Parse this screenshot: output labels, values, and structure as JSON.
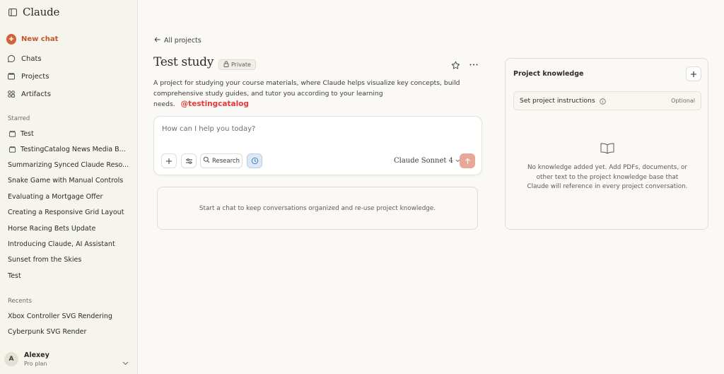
{
  "sidebar": {
    "brand": "Claude",
    "new_chat": "New chat",
    "nav": [
      {
        "label": "Chats",
        "icon": "chat-bubble-icon"
      },
      {
        "label": "Projects",
        "icon": "folder-icon"
      },
      {
        "label": "Artifacts",
        "icon": "artifacts-grid-icon"
      }
    ],
    "starred_heading": "Starred",
    "starred": [
      {
        "label": "Test",
        "icon": "folder-icon"
      },
      {
        "label": "TestingCatalog News Media B...",
        "icon": "folder-icon"
      },
      {
        "label": "Summarizing Synced Claude Reso..."
      },
      {
        "label": "Snake Game with Manual Controls"
      },
      {
        "label": "Evaluating a Mortgage Offer"
      },
      {
        "label": "Creating a Responsive Grid Layout"
      },
      {
        "label": "Horse Racing Bets Update"
      },
      {
        "label": "Introducing Claude, AI Assistant"
      },
      {
        "label": "Sunset from the Skies"
      },
      {
        "label": "Test"
      }
    ],
    "recents_heading": "Recents",
    "recents": [
      {
        "label": "Xbox Controller SVG Rendering"
      },
      {
        "label": "Cyberpunk SVG Render"
      }
    ],
    "user": {
      "initial": "A",
      "name": "Alexey",
      "plan": "Pro plan"
    }
  },
  "main": {
    "back_label": "All projects",
    "title": "Test study",
    "badge": "Private",
    "description": "A project for studying your course materials, where Claude helps visualize key concepts, build comprehensive study guides, and tutor you according to your learning needs.",
    "watermark": "@testingcatalog",
    "composer": {
      "placeholder": "How can I help you today?",
      "research_label": "Research",
      "model": "Claude Sonnet 4"
    },
    "empty_message": "Start a chat to keep conversations organized and re-use project knowledge."
  },
  "knowledge": {
    "title": "Project knowledge",
    "instructions_label": "Set project instructions",
    "instructions_tag": "Optional",
    "empty_message": "No knowledge added yet. Add PDFs, documents, or other text to the project knowledge base that Claude will reference in every project conversation."
  },
  "colors": {
    "accent": "#d4633a",
    "background": "#faf9f5",
    "sidebar": "#f5f4ed",
    "send_button": "#e8a797",
    "watermark": "#e03a3a"
  }
}
